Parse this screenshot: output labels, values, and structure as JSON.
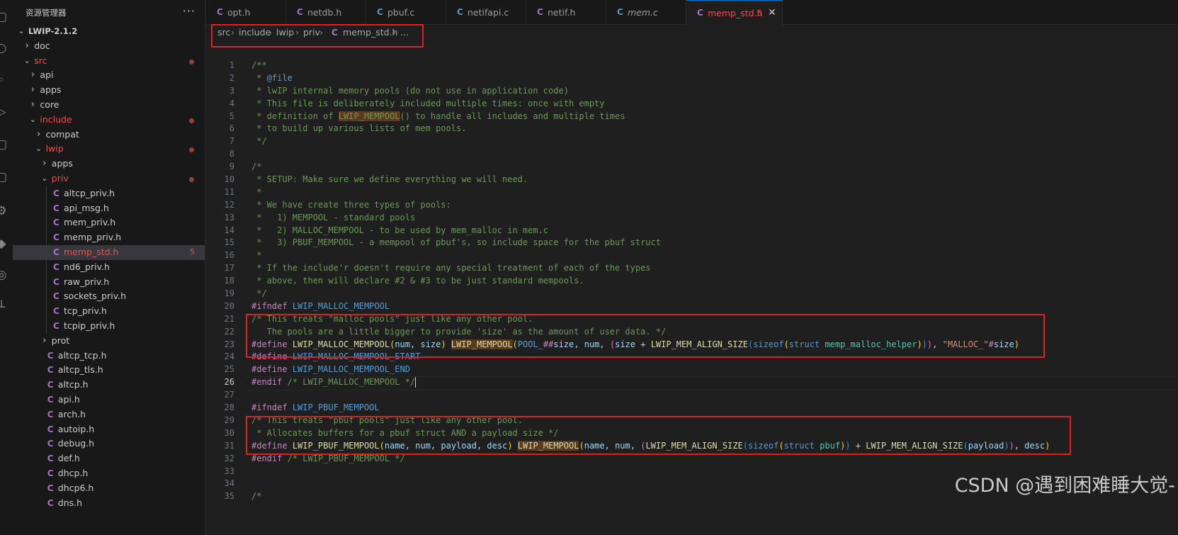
{
  "explorer": {
    "title": "资源管理器",
    "more": "···",
    "tree": [
      {
        "label": "LWIP-2.1.2",
        "depth": 0,
        "kind": "folder",
        "open": true,
        "root": true
      },
      {
        "label": "doc",
        "depth": 1,
        "kind": "folder",
        "open": false
      },
      {
        "label": "src",
        "depth": 1,
        "kind": "folder",
        "open": true,
        "status": "modified-dot"
      },
      {
        "label": "api",
        "depth": 2,
        "kind": "folder",
        "open": false
      },
      {
        "label": "apps",
        "depth": 2,
        "kind": "folder",
        "open": false
      },
      {
        "label": "core",
        "depth": 2,
        "kind": "folder",
        "open": false
      },
      {
        "label": "include",
        "depth": 2,
        "kind": "folder",
        "open": true,
        "status": "modified-dot"
      },
      {
        "label": "compat",
        "depth": 3,
        "kind": "folder",
        "open": false
      },
      {
        "label": "lwip",
        "depth": 3,
        "kind": "folder",
        "open": true,
        "status": "modified-dot"
      },
      {
        "label": "apps",
        "depth": 4,
        "kind": "folder",
        "open": false
      },
      {
        "label": "priv",
        "depth": 4,
        "kind": "folder",
        "open": true,
        "status": "modified-dot"
      },
      {
        "label": "altcp_priv.h",
        "depth": 5,
        "kind": "c"
      },
      {
        "label": "api_msg.h",
        "depth": 5,
        "kind": "c"
      },
      {
        "label": "mem_priv.h",
        "depth": 5,
        "kind": "c"
      },
      {
        "label": "memp_priv.h",
        "depth": 5,
        "kind": "c"
      },
      {
        "label": "memp_std.h",
        "depth": 5,
        "kind": "c",
        "selected": true,
        "badge": "5"
      },
      {
        "label": "nd6_priv.h",
        "depth": 5,
        "kind": "c"
      },
      {
        "label": "raw_priv.h",
        "depth": 5,
        "kind": "c"
      },
      {
        "label": "sockets_priv.h",
        "depth": 5,
        "kind": "c"
      },
      {
        "label": "tcp_priv.h",
        "depth": 5,
        "kind": "c"
      },
      {
        "label": "tcpip_priv.h",
        "depth": 5,
        "kind": "c"
      },
      {
        "label": "prot",
        "depth": 4,
        "kind": "folder",
        "open": false
      },
      {
        "label": "altcp_tcp.h",
        "depth": 4,
        "kind": "c"
      },
      {
        "label": "altcp_tls.h",
        "depth": 4,
        "kind": "c"
      },
      {
        "label": "altcp.h",
        "depth": 4,
        "kind": "c"
      },
      {
        "label": "api.h",
        "depth": 4,
        "kind": "c"
      },
      {
        "label": "arch.h",
        "depth": 4,
        "kind": "c"
      },
      {
        "label": "autoip.h",
        "depth": 4,
        "kind": "c"
      },
      {
        "label": "debug.h",
        "depth": 4,
        "kind": "c"
      },
      {
        "label": "def.h",
        "depth": 4,
        "kind": "c"
      },
      {
        "label": "dhcp.h",
        "depth": 4,
        "kind": "c"
      },
      {
        "label": "dhcp6.h",
        "depth": 4,
        "kind": "c"
      },
      {
        "label": "dns.h",
        "depth": 4,
        "kind": "c"
      }
    ]
  },
  "tabs": [
    {
      "label": "opt.h",
      "icon": "c-icon",
      "icon_color": "#a074c4"
    },
    {
      "label": "netdb.h",
      "icon": "c-icon",
      "icon_color": "#a074c4"
    },
    {
      "label": "pbuf.c",
      "icon": "c-icon",
      "icon_color": "#519aba"
    },
    {
      "label": "netifapi.c",
      "icon": "c-icon",
      "icon_color": "#519aba"
    },
    {
      "label": "netif.h",
      "icon": "c-icon",
      "icon_color": "#a074c4"
    },
    {
      "label": "mem.c",
      "icon": "c-icon",
      "icon_color": "#519aba",
      "italic": true
    },
    {
      "label": "memp_std.h",
      "icon": "c-icon",
      "icon_color": "#a074c4",
      "active": true,
      "badge": "5",
      "close": "✕"
    }
  ],
  "breadcrumb": [
    "src",
    "include",
    "lwip",
    "priv",
    "memp_std.h",
    "..."
  ],
  "breadcrumb_sep": "›",
  "icon_letter": "C",
  "editor": {
    "current_line": 26,
    "lines": [
      [
        [
          "c",
          "/**"
        ]
      ],
      [
        [
          "c",
          " * "
        ],
        [
          "dt",
          "@file"
        ]
      ],
      [
        [
          "c",
          " * lwIP internal memory pools (do not use in application code)"
        ]
      ],
      [
        [
          "c",
          " * This file is deliberately included multiple times: once with empty"
        ]
      ],
      [
        [
          "c",
          " * definition of "
        ],
        [
          "c hl",
          "LWIP_MEMPOOL"
        ],
        [
          "c",
          "() to handle all includes and multiple times"
        ]
      ],
      [
        [
          "c",
          " * to build up various lists of mem pools."
        ]
      ],
      [
        [
          "c",
          " */"
        ]
      ],
      [
        [
          "",
          ""
        ]
      ],
      [
        [
          "c",
          "/*"
        ]
      ],
      [
        [
          "c",
          " * SETUP: Make sure we define everything we will need."
        ]
      ],
      [
        [
          "c",
          " *"
        ]
      ],
      [
        [
          "c",
          " * We have create three types of pools:"
        ]
      ],
      [
        [
          "c",
          " *   1) MEMPOOL - standard pools"
        ]
      ],
      [
        [
          "c",
          " *   2) MALLOC_MEMPOOL - to be used by mem_malloc in mem.c"
        ]
      ],
      [
        [
          "c",
          " *   3) PBUF_MEMPOOL - a mempool of pbuf's, so include space for the pbuf struct"
        ]
      ],
      [
        [
          "c",
          " *"
        ]
      ],
      [
        [
          "c",
          " * If the include'r doesn't require any special treatment of each of the types"
        ]
      ],
      [
        [
          "c",
          " * above, then will declare #2 & #3 to be just standard mempools."
        ]
      ],
      [
        [
          "c",
          " */"
        ]
      ],
      [
        [
          "kw",
          "#ifndef"
        ],
        [
          "",
          " "
        ],
        [
          "dt",
          "LWIP_MALLOC_MEMPOOL"
        ]
      ],
      [
        [
          "c",
          "/* This treats \"malloc pools\" just like any other pool."
        ]
      ],
      [
        [
          "c",
          "   The pools are a little bigger to provide 'size' as the amount of user data. */"
        ]
      ],
      [
        [
          "kw",
          "#define"
        ],
        [
          "",
          " "
        ],
        [
          "fn",
          "LWIP_MALLOC_MEMPOOL"
        ],
        [
          "p1",
          "("
        ],
        [
          "var",
          "num"
        ],
        [
          "",
          ", "
        ],
        [
          "var",
          "size"
        ],
        [
          "p1",
          ")"
        ],
        [
          "",
          " "
        ],
        [
          "fn hl",
          "LWIP_MEMPOOL"
        ],
        [
          "p1",
          "("
        ],
        [
          "dt",
          "POOL_"
        ],
        [
          "kw",
          "##"
        ],
        [
          "var",
          "size"
        ],
        [
          "",
          ", "
        ],
        [
          "var",
          "num"
        ],
        [
          "",
          ", "
        ],
        [
          "p2",
          "("
        ],
        [
          "var",
          "size"
        ],
        [
          "",
          " + "
        ],
        [
          "fn",
          "LWIP_MEM_ALIGN_SIZE"
        ],
        [
          "p3",
          "("
        ],
        [
          "dt",
          "sizeof"
        ],
        [
          "p1",
          "("
        ],
        [
          "dt",
          "struct"
        ],
        [
          "",
          " "
        ],
        [
          "ty",
          "memp_malloc_helper"
        ],
        [
          "p1",
          ")"
        ],
        [
          "p3",
          ")"
        ],
        [
          "p2",
          ")"
        ],
        [
          "",
          ", "
        ],
        [
          "str",
          "\"MALLOC_\""
        ],
        [
          "kw",
          "#"
        ],
        [
          "var",
          "size"
        ],
        [
          "p1",
          ")"
        ]
      ],
      [
        [
          "kw",
          "#define"
        ],
        [
          "",
          " "
        ],
        [
          "dt",
          "LWIP_MALLOC_MEMPOOL_START"
        ]
      ],
      [
        [
          "kw",
          "#define"
        ],
        [
          "",
          " "
        ],
        [
          "dt",
          "LWIP_MALLOC_MEMPOOL_END"
        ]
      ],
      [
        [
          "kw",
          "#endif"
        ],
        [
          "",
          " "
        ],
        [
          "c",
          "/* LWIP_MALLOC_MEMPOOL */"
        ],
        [
          "cursor",
          ""
        ]
      ],
      [
        [
          "",
          ""
        ]
      ],
      [
        [
          "kw",
          "#ifndef"
        ],
        [
          "",
          " "
        ],
        [
          "dt",
          "LWIP_PBUF_MEMPOOL"
        ]
      ],
      [
        [
          "c",
          "/* This treats \"pbuf pools\" just like any other pool."
        ]
      ],
      [
        [
          "c",
          " * Allocates buffers for a pbuf struct AND a payload size */"
        ]
      ],
      [
        [
          "kw",
          "#define"
        ],
        [
          "",
          " "
        ],
        [
          "fn",
          "LWIP_PBUF_MEMPOOL"
        ],
        [
          "p1",
          "("
        ],
        [
          "var",
          "name"
        ],
        [
          "",
          ", "
        ],
        [
          "var",
          "num"
        ],
        [
          "",
          ", "
        ],
        [
          "var",
          "payload"
        ],
        [
          "",
          ", "
        ],
        [
          "var",
          "desc"
        ],
        [
          "p1",
          ")"
        ],
        [
          "",
          " "
        ],
        [
          "fn hl",
          "LWIP_MEMPOOL"
        ],
        [
          "p1",
          "("
        ],
        [
          "var",
          "name"
        ],
        [
          "",
          ", "
        ],
        [
          "var",
          "num"
        ],
        [
          "",
          ", "
        ],
        [
          "p2",
          "("
        ],
        [
          "fn",
          "LWIP_MEM_ALIGN_SIZE"
        ],
        [
          "p3",
          "("
        ],
        [
          "dt",
          "sizeof"
        ],
        [
          "p1",
          "("
        ],
        [
          "dt",
          "struct"
        ],
        [
          "",
          " "
        ],
        [
          "ty",
          "pbuf"
        ],
        [
          "p1",
          ")"
        ],
        [
          "p3",
          ")"
        ],
        [
          "",
          " + "
        ],
        [
          "fn",
          "LWIP_MEM_ALIGN_SIZE"
        ],
        [
          "p3",
          "("
        ],
        [
          "var",
          "payload"
        ],
        [
          "p3",
          ")"
        ],
        [
          "p2",
          ")"
        ],
        [
          "",
          ", "
        ],
        [
          "var",
          "desc"
        ],
        [
          "p1",
          ")"
        ]
      ],
      [
        [
          "kw",
          "#endif"
        ],
        [
          "",
          " "
        ],
        [
          "c",
          "/* LWIP_PBUF_MEMPOOL */"
        ]
      ],
      [
        [
          "",
          ""
        ]
      ],
      [
        [
          "",
          ""
        ]
      ],
      [
        [
          "c",
          "/*"
        ]
      ]
    ]
  },
  "watermark": "CSDN @遇到困难睡大觉-",
  "colors": {
    "accent": "#0078d4",
    "error": "#f14c4c",
    "annotation": "#e0201e",
    "c_file": "#a074c4"
  }
}
